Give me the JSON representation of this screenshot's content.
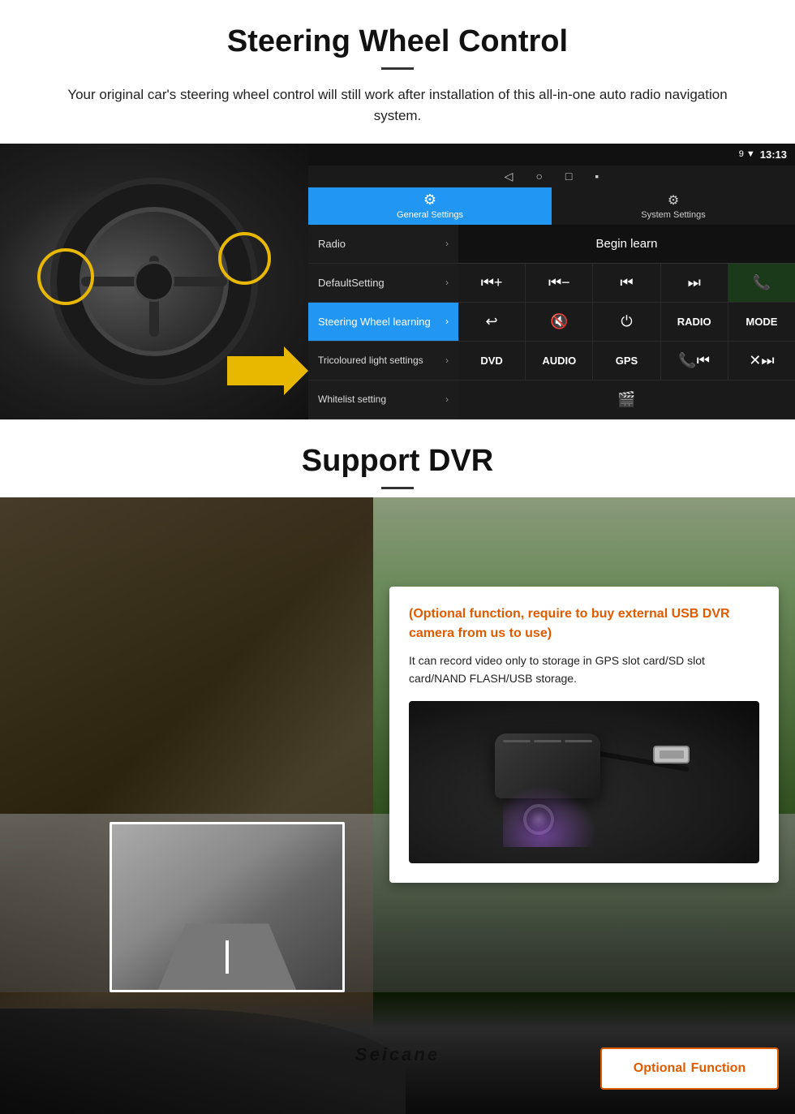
{
  "section1": {
    "title": "Steering Wheel Control",
    "description": "Your original car's steering wheel control will still work after installation of this all-in-one auto radio navigation system.",
    "ui": {
      "statusbar": {
        "time": "13:13",
        "icons": "▼ 9"
      },
      "tabs": {
        "general": {
          "icon": "⚙",
          "label": "General Settings"
        },
        "system": {
          "icon": "🔧",
          "label": "System Settings"
        }
      },
      "menu": [
        {
          "label": "Radio",
          "active": false
        },
        {
          "label": "DefaultSetting",
          "active": false
        },
        {
          "label": "Steering Wheel learning",
          "active": true
        },
        {
          "label": "Tricoloured light settings",
          "active": false
        },
        {
          "label": "Whitelist setting",
          "active": false
        }
      ],
      "begin_learn": "Begin learn",
      "control_rows": [
        [
          "⏮+",
          "⏮-",
          "⏮⏮",
          "⏭⏭",
          "📞"
        ],
        [
          "↩",
          "🔇",
          "⏻",
          "RADIO",
          "MODE"
        ],
        [
          "DVD",
          "AUDIO",
          "GPS",
          "📞⏮",
          "✕⏭"
        ]
      ]
    }
  },
  "section2": {
    "title": "Support DVR",
    "infobox": {
      "title": "(Optional function, require to buy external USB DVR camera from us to use)",
      "text": "It can record video only to storage in GPS slot card/SD slot card/NAND FLASH/USB storage."
    },
    "optional_button": {
      "optional_label": "Optional",
      "function_label": "Function"
    },
    "brand": "Seicane"
  }
}
